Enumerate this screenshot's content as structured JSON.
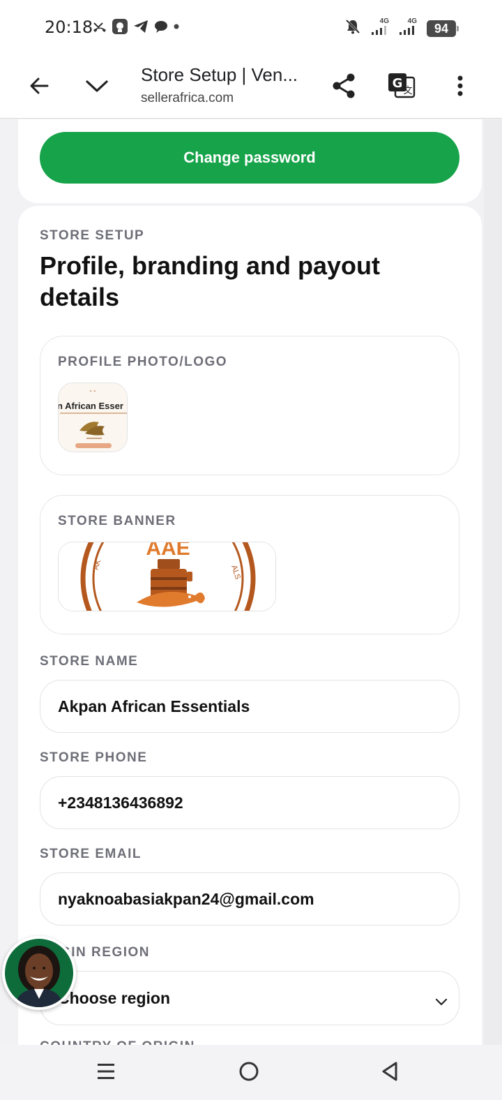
{
  "status_bar": {
    "time": "20:18",
    "net1": "4G",
    "net2": "4G",
    "battery": "94"
  },
  "toolbar": {
    "title": "Store Setup | Ven...",
    "url": "sellerafrica.com"
  },
  "account": {
    "change_password_label": "Change password"
  },
  "store_setup": {
    "eyebrow": "STORE SETUP",
    "heading": "Profile, branding and payout details",
    "profile_photo": {
      "label": "PROFILE PHOTO/LOGO",
      "logo_text": "n African Esser"
    },
    "store_banner": {
      "label": "STORE BANNER",
      "banner_text": "AAE"
    },
    "store_name": {
      "label": "STORE NAME",
      "value": "Akpan African Essentials"
    },
    "store_phone": {
      "label": "STORE PHONE",
      "value": "+2348136436892"
    },
    "store_email": {
      "label": "STORE EMAIL",
      "value": "nyaknoabasiakpan24@gmail.com"
    },
    "origin_region": {
      "label": "GIN REGION",
      "selected": "Choose region"
    },
    "country_origin": {
      "label": "COUNTRY OF ORIGIN"
    }
  },
  "colors": {
    "accent_green": "#17a34a",
    "label_gray": "#6e6e78",
    "banner_brown": "#b4581e"
  },
  "icons": {
    "back": "arrow-left-icon",
    "collapse": "chevron-down-icon",
    "share": "share-icon",
    "translate": "google-translate-icon",
    "more": "more-vert-icon"
  }
}
